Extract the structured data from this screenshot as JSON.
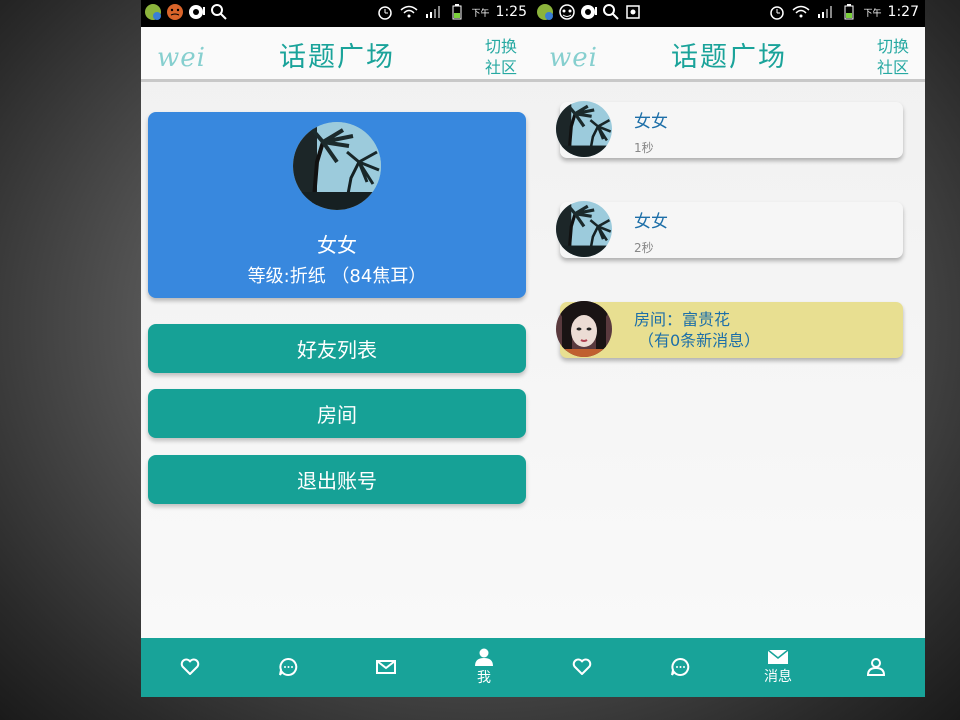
{
  "left": {
    "status": {
      "period": "下午",
      "time": "1:25"
    },
    "header": {
      "logo": "wei",
      "title": "话题广场",
      "switch_line1": "切换",
      "switch_line2": "社区"
    },
    "profile": {
      "name": "女女",
      "level": "等级:折纸 （84焦耳）"
    },
    "menu": [
      "好友列表",
      "房间",
      "退出账号"
    ],
    "nav": [
      {
        "icon": "heart-icon",
        "label": ""
      },
      {
        "icon": "chat-bubble-icon",
        "label": ""
      },
      {
        "icon": "mail-icon",
        "label": ""
      },
      {
        "icon": "person-icon",
        "label": "我"
      }
    ]
  },
  "right": {
    "status": {
      "period": "下午",
      "time": "1:27"
    },
    "header": {
      "logo": "wei",
      "title": "话题广场",
      "switch_line1": "切换",
      "switch_line2": "社区"
    },
    "messages": [
      {
        "name": "女女",
        "time": "1秒"
      },
      {
        "name": "女女",
        "time": "2秒"
      }
    ],
    "room": {
      "line1": "房间：富贵花",
      "line2": "（有0条新消息）"
    },
    "nav": [
      {
        "icon": "heart-icon",
        "label": ""
      },
      {
        "icon": "chat-bubble-icon",
        "label": ""
      },
      {
        "icon": "mail-icon",
        "label": "消息"
      },
      {
        "icon": "person-icon",
        "label": ""
      }
    ]
  },
  "colors": {
    "accent_teal": "#16a196",
    "profile_blue": "#3888de",
    "room_yellow": "#e8df91",
    "title_teal": "#1aa39a"
  }
}
